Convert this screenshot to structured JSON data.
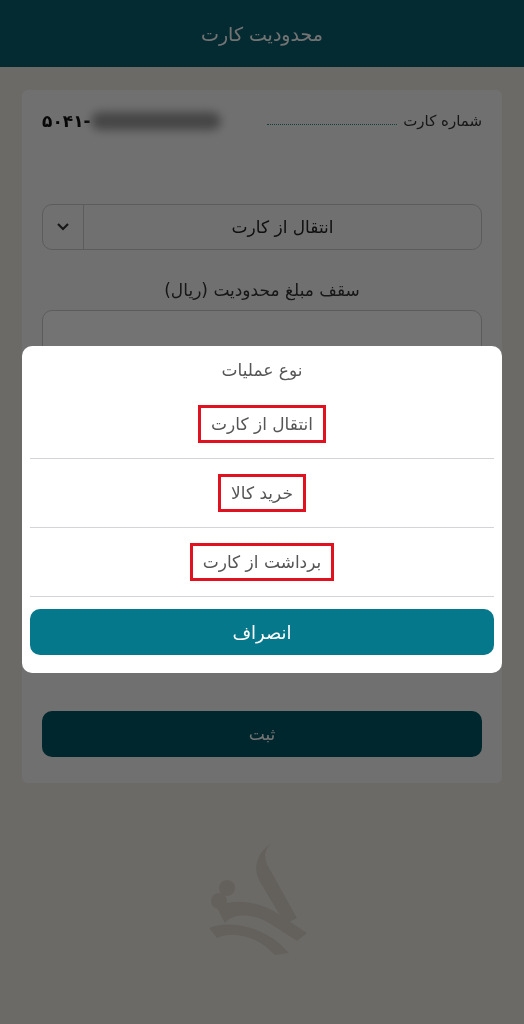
{
  "app_bar": {
    "title": "محدودیت کارت"
  },
  "form": {
    "card_number_label": "شماره کارت",
    "card_number": "۵۰۴۱-",
    "card_number_masked": true,
    "operation_select": {
      "value": "انتقال از کارت"
    },
    "limit_label": "سقف مبلغ محدودیت (ریال)",
    "submit_button": "ثبت"
  },
  "dialog": {
    "title": "نوع عملیات",
    "options": [
      {
        "label": "انتقال از کارت",
        "highlighted": true
      },
      {
        "label": "خرید کالا",
        "highlighted": true
      },
      {
        "label": "برداشت از کارت",
        "highlighted": true
      }
    ],
    "cancel_button": "انصراف"
  }
}
